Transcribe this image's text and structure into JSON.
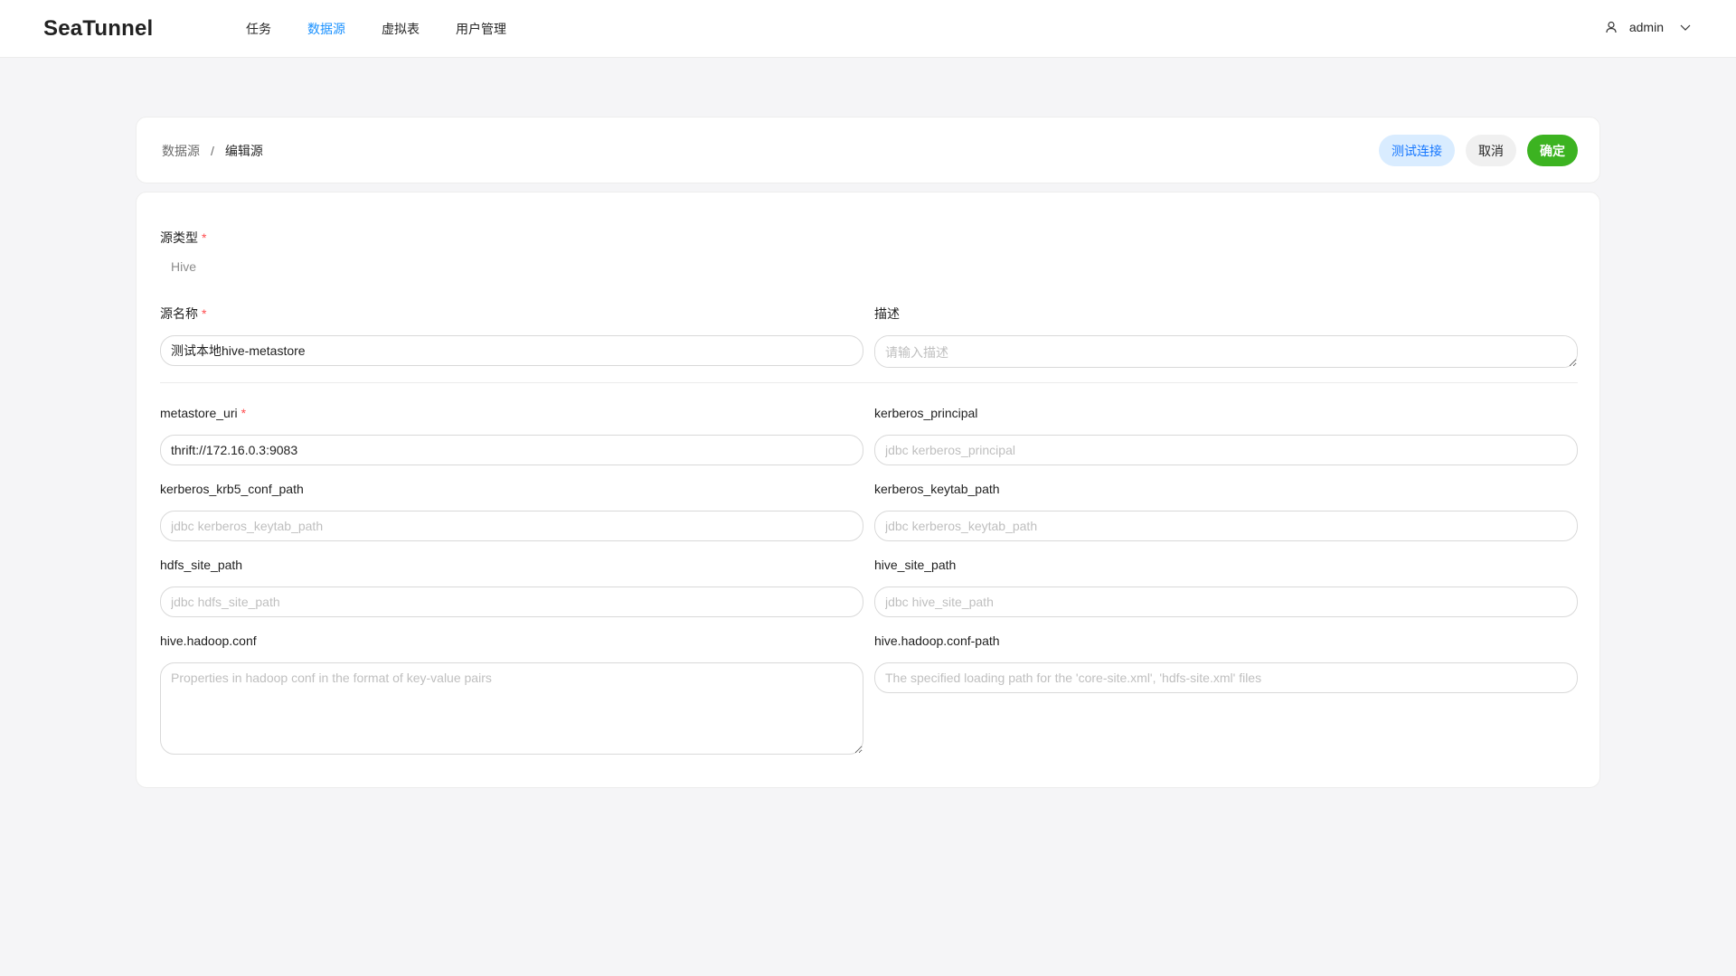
{
  "app": {
    "logo": "SeaTunnel",
    "nav": [
      "任务",
      "数据源",
      "虚拟表",
      "用户管理"
    ],
    "user": "admin"
  },
  "breadcrumb": {
    "parent": "数据源",
    "separator": "/",
    "current": "编辑源"
  },
  "actions": {
    "test": "测试连接",
    "cancel": "取消",
    "ok": "确定"
  },
  "form": {
    "source_type": {
      "label": "源类型",
      "value": "Hive"
    },
    "source_name": {
      "label": "源名称",
      "value": "测试本地hive-metastore"
    },
    "description": {
      "label": "描述",
      "placeholder": "请输入描述"
    },
    "metastore_uri": {
      "label": "metastore_uri",
      "value": "thrift://172.16.0.3:9083"
    },
    "kerberos_principal": {
      "label": "kerberos_principal",
      "placeholder": "jdbc kerberos_principal"
    },
    "kerberos_krb5_conf_path": {
      "label": "kerberos_krb5_conf_path",
      "placeholder": "jdbc kerberos_keytab_path"
    },
    "kerberos_keytab_path": {
      "label": "kerberos_keytab_path",
      "placeholder": "jdbc kerberos_keytab_path"
    },
    "hdfs_site_path": {
      "label": "hdfs_site_path",
      "placeholder": "jdbc hdfs_site_path"
    },
    "hive_site_path": {
      "label": "hive_site_path",
      "placeholder": "jdbc hive_site_path"
    },
    "hive_hadoop_conf": {
      "label": "hive.hadoop.conf",
      "placeholder": "Properties in hadoop conf in the format of key-value pairs"
    },
    "hive_hadoop_conf_path": {
      "label": "hive.hadoop.conf-path",
      "placeholder": "The specified loading path for the 'core-site.xml', 'hdfs-site.xml' files"
    }
  },
  "colors": {
    "primary": "#1890ff",
    "success": "#3cb321",
    "required": "#ff4d4f"
  },
  "icons": {
    "user": "user-icon",
    "dropdown": "chevron-down-icon"
  }
}
